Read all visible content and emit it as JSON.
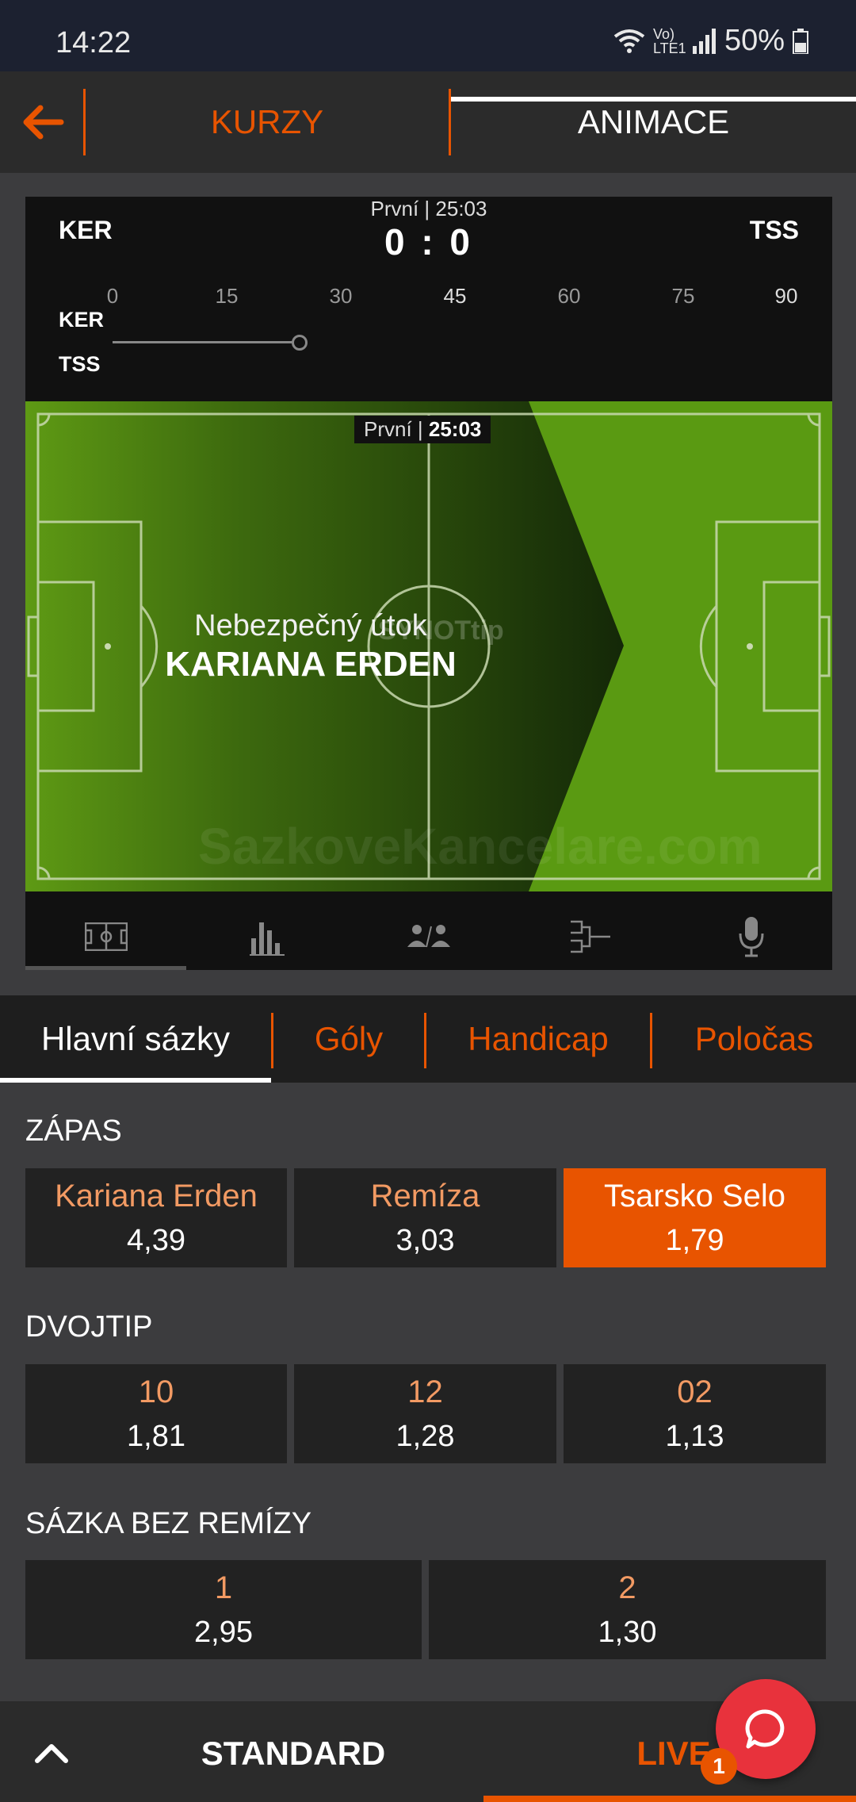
{
  "status_bar": {
    "time": "14:22",
    "network": "Vo) LTE1",
    "battery": "50%"
  },
  "nav": {
    "tab_kurzy": "KURZY",
    "tab_animace": "ANIMACE"
  },
  "tracker": {
    "home_abbr": "KER",
    "away_abbr": "TSS",
    "period_time": "První | 25:03",
    "score": "0 : 0",
    "timeline_ticks": [
      "0",
      "15",
      "30",
      "45",
      "60",
      "75",
      "90"
    ],
    "timeline_progress_minutes": 25,
    "pitch_badge_period": "První",
    "pitch_badge_time": "25:03",
    "event_title": "Nebezpečný útok",
    "event_team": "KARIANA ERDEN",
    "watermark_logo": "SYNOTtip"
  },
  "market_tabs": [
    "Hlavní sázky",
    "Góly",
    "Handicap",
    "Poločas"
  ],
  "markets": {
    "zapas": {
      "title": "ZÁPAS",
      "options": [
        {
          "label": "Kariana Erden",
          "odds": "4,39"
        },
        {
          "label": "Remíza",
          "odds": "3,03"
        },
        {
          "label": "Tsarsko Selo",
          "odds": "1,79"
        }
      ]
    },
    "dvojtip": {
      "title": "DVOJTIP",
      "options": [
        {
          "label": "10",
          "odds": "1,81"
        },
        {
          "label": "12",
          "odds": "1,28"
        },
        {
          "label": "02",
          "odds": "1,13"
        }
      ]
    },
    "bez_remizy": {
      "title": "SÁZKA BEZ REMÍZY",
      "options": [
        {
          "label": "1",
          "odds": "2,95"
        },
        {
          "label": "2",
          "odds": "1,30"
        }
      ]
    }
  },
  "bottom_bar": {
    "standard": "STANDARD",
    "live": "LIVE",
    "chat_badge": "1"
  },
  "watermark": "SazkoveKancelare.com",
  "colors": {
    "accent": "#e85400",
    "pitch_green": "#5a9a12",
    "chat": "#e8323c"
  }
}
